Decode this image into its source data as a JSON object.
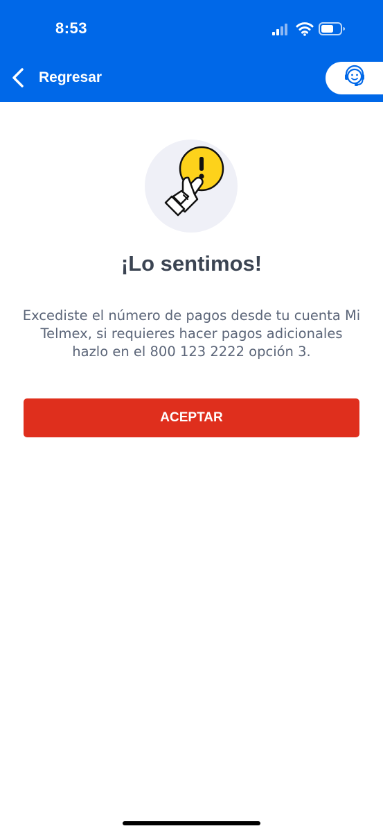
{
  "status_bar": {
    "time": "8:53",
    "icons": [
      "cellular-signal-icon",
      "wifi-icon",
      "battery-icon"
    ]
  },
  "header": {
    "back_label": "Regresar",
    "support_icon": "support-agent-icon"
  },
  "dialog": {
    "illustration_icon": "hand-warning-icon",
    "title": "¡Lo sentimos!",
    "message": "Excediste el número de pagos desde tu cuenta Mi Telmex, si requieres hacer pagos adicionales hazlo en el 800 123 2222 opción 3.",
    "accept_label": "ACEPTAR"
  },
  "colors": {
    "header_blue": "#0068e8",
    "accept_red": "#df2f1d",
    "warning_yellow": "#fdd21b",
    "title_text": "#3b4452",
    "body_text": "#5b6578"
  }
}
